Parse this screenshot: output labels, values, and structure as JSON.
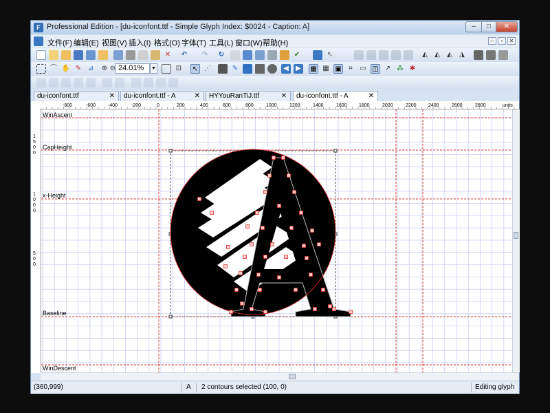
{
  "window": {
    "title": "Professional Edition - [du-iconfont.ttf - Simple Glyph Index: $0024 - Caption: A]",
    "min_label": "–",
    "max_label": "□",
    "close_label": "✕"
  },
  "menu": [
    "文件(F)",
    "编辑(E)",
    "视图(V)",
    "插入(I)",
    "格式(O)",
    "字体(T)",
    "工具(L)",
    "窗口(W)",
    "帮助(H)"
  ],
  "mdi_controls": [
    "–",
    "▫",
    "✕"
  ],
  "toolbar2": {
    "zoom_value": "24.01%"
  },
  "tabs": [
    {
      "label": "du-iconfont.ttf",
      "close": "✕"
    },
    {
      "label": "du-iconfont.ttf - A",
      "close": "✕"
    },
    {
      "label": "HYYouRanTiJ.ttf",
      "close": "✕"
    },
    {
      "label": "du-iconfont.ttf - A",
      "close": "✕"
    }
  ],
  "ruler_h_labels": [
    "-800",
    "-600",
    "-400",
    "-200",
    "0",
    "200",
    "400",
    "600",
    "800",
    "1000",
    "1200",
    "1400",
    "1600",
    "1800",
    "2000",
    "2200",
    "2400",
    "2600",
    "2800",
    "units"
  ],
  "ruler_v_labels": [
    "1",
    "5",
    "0",
    "0",
    "1",
    "0",
    "0",
    "0",
    "5",
    "0",
    "0"
  ],
  "guides": {
    "win_ascent": "WinAscent",
    "cap_height": "CapHeight",
    "x_height": "x-Height",
    "baseline": "Baseline",
    "win_descent": "WinDescent"
  },
  "status": {
    "coords": "(360,999)",
    "char": "A",
    "selection": "2 contours selected (100, 0)",
    "mode": "Editing glyph"
  },
  "colors": {
    "guide_red": "#e03030",
    "grid_blue": "#c9cdf0",
    "node_red": "#e83030",
    "glyph_black": "#000000"
  }
}
